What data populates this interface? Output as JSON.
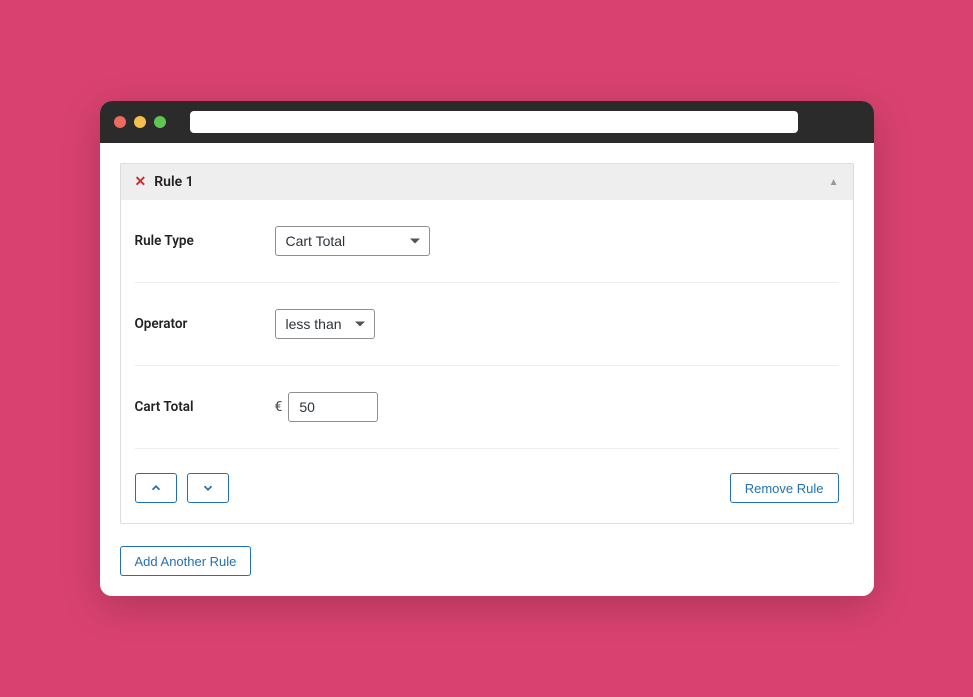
{
  "rule": {
    "title": "Rule 1",
    "fields": {
      "rule_type_label": "Rule Type",
      "rule_type_value": "Cart Total",
      "operator_label": "Operator",
      "operator_value": "less than",
      "cart_total_label": "Cart Total",
      "currency_symbol": "€",
      "cart_total_value": "50"
    },
    "remove_label": "Remove Rule"
  },
  "add_rule_label": "Add Another Rule"
}
